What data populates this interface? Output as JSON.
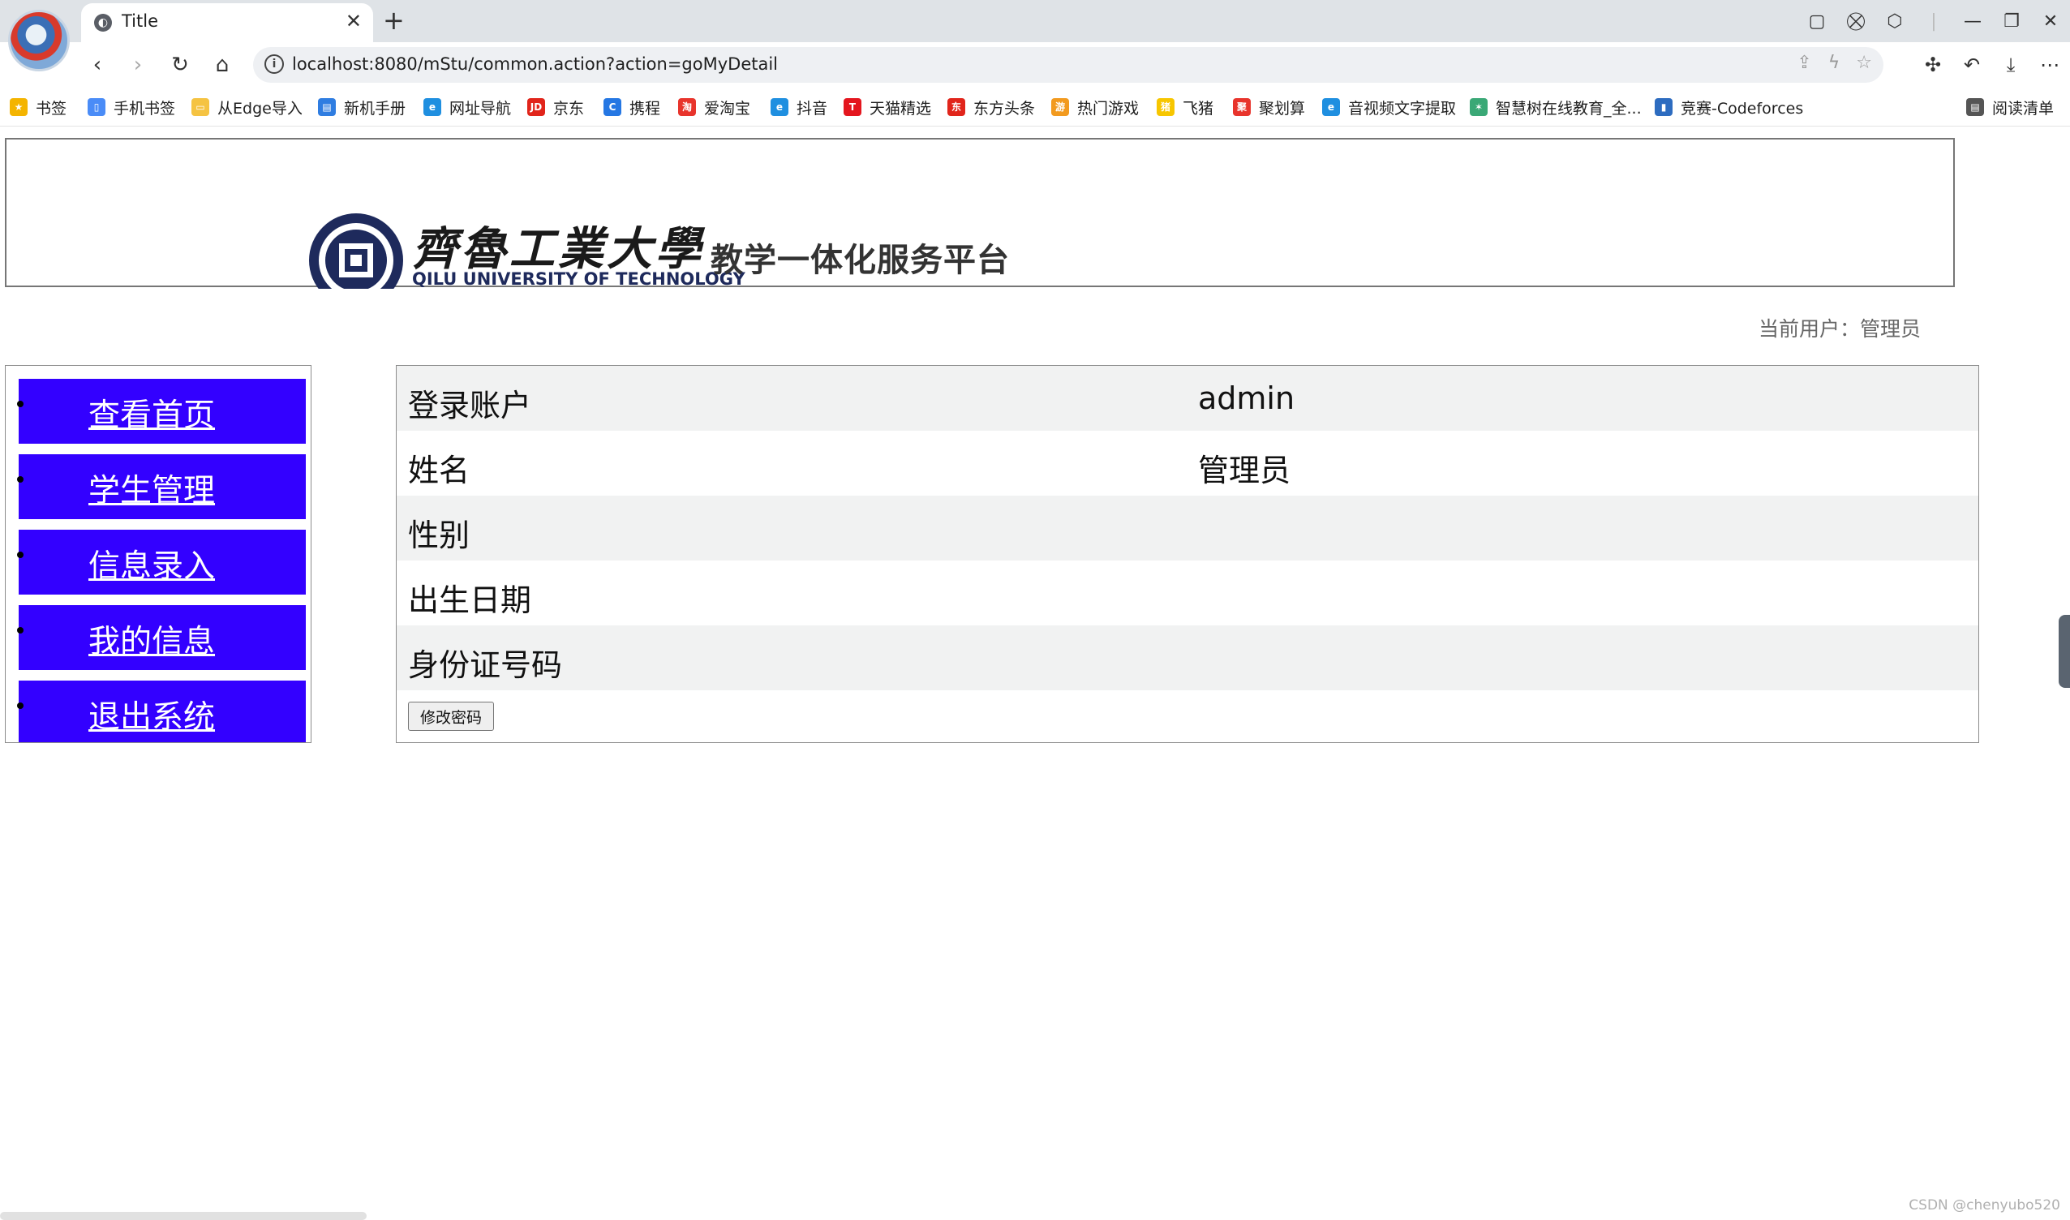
{
  "browser": {
    "tab_title": "Title",
    "tab_close": "✕",
    "new_tab": "+",
    "url": "localhost:8080/mStu/common.action?action=goMyDetail",
    "window_controls": [
      "—",
      "❐",
      "✕"
    ]
  },
  "bookmarks": [
    {
      "label": "书签",
      "icon": "star-icon",
      "color": "#f4b400"
    },
    {
      "label": "手机书签",
      "icon": "phone-bookmark-icon",
      "color": "#4a8cf7"
    },
    {
      "label": "从Edge导入",
      "icon": "folder-icon",
      "color": "#f5c342"
    },
    {
      "label": "新机手册",
      "icon": "doc-icon",
      "color": "#2f7de1"
    },
    {
      "label": "网址导航",
      "icon": "edge-icon",
      "color": "#1f8fe0"
    },
    {
      "label": "京东",
      "icon": "jd-icon",
      "color": "#e1251b"
    },
    {
      "label": "携程",
      "icon": "ctrip-icon",
      "color": "#2577e3"
    },
    {
      "label": "爱淘宝",
      "icon": "taobao-icon",
      "color": "#e8342c"
    },
    {
      "label": "抖音",
      "icon": "edge-icon",
      "color": "#1f8fe0"
    },
    {
      "label": "天猫精选",
      "icon": "tmall-icon",
      "color": "#e4161e"
    },
    {
      "label": "东方头条",
      "icon": "dftt-icon",
      "color": "#e1251b"
    },
    {
      "label": "热门游戏",
      "icon": "game-icon",
      "color": "#f29a1f"
    },
    {
      "label": "飞猪",
      "icon": "fliggy-icon",
      "color": "#f7c600"
    },
    {
      "label": "聚划算",
      "icon": "juhuasuan-icon",
      "color": "#e8342c"
    },
    {
      "label": "音视频文字提取",
      "icon": "edge-icon",
      "color": "#1f8fe0"
    },
    {
      "label": "智慧树在线教育_全...",
      "icon": "zhihuishu-icon",
      "color": "#3aa876"
    },
    {
      "label": "竞赛-Codeforces",
      "icon": "chart-icon",
      "color": "#2d6cc0"
    },
    {
      "label": "阅读清单",
      "icon": "reading-list-icon",
      "color": "#555555"
    }
  ],
  "page": {
    "school_name_cn": "齊魯工業大學",
    "school_name_en": "QILU UNIVERSITY OF TECHNOLOGY",
    "platform_title": "教学一体化服务平台",
    "current_user_label": "当前用户：管理员",
    "menu": [
      {
        "label": "查看首页"
      },
      {
        "label": "学生管理"
      },
      {
        "label": "信息录入"
      },
      {
        "label": "我的信息"
      },
      {
        "label": "退出系统"
      }
    ],
    "detail_rows": [
      {
        "label": "登录账户",
        "value": "admin"
      },
      {
        "label": "姓名",
        "value": "管理员"
      },
      {
        "label": "性别",
        "value": ""
      },
      {
        "label": "出生日期",
        "value": ""
      },
      {
        "label": "身份证号码",
        "value": ""
      }
    ],
    "change_password_label": "修改密码",
    "accent_color": "#3300ff"
  },
  "watermark": "CSDN @chenyubo520"
}
